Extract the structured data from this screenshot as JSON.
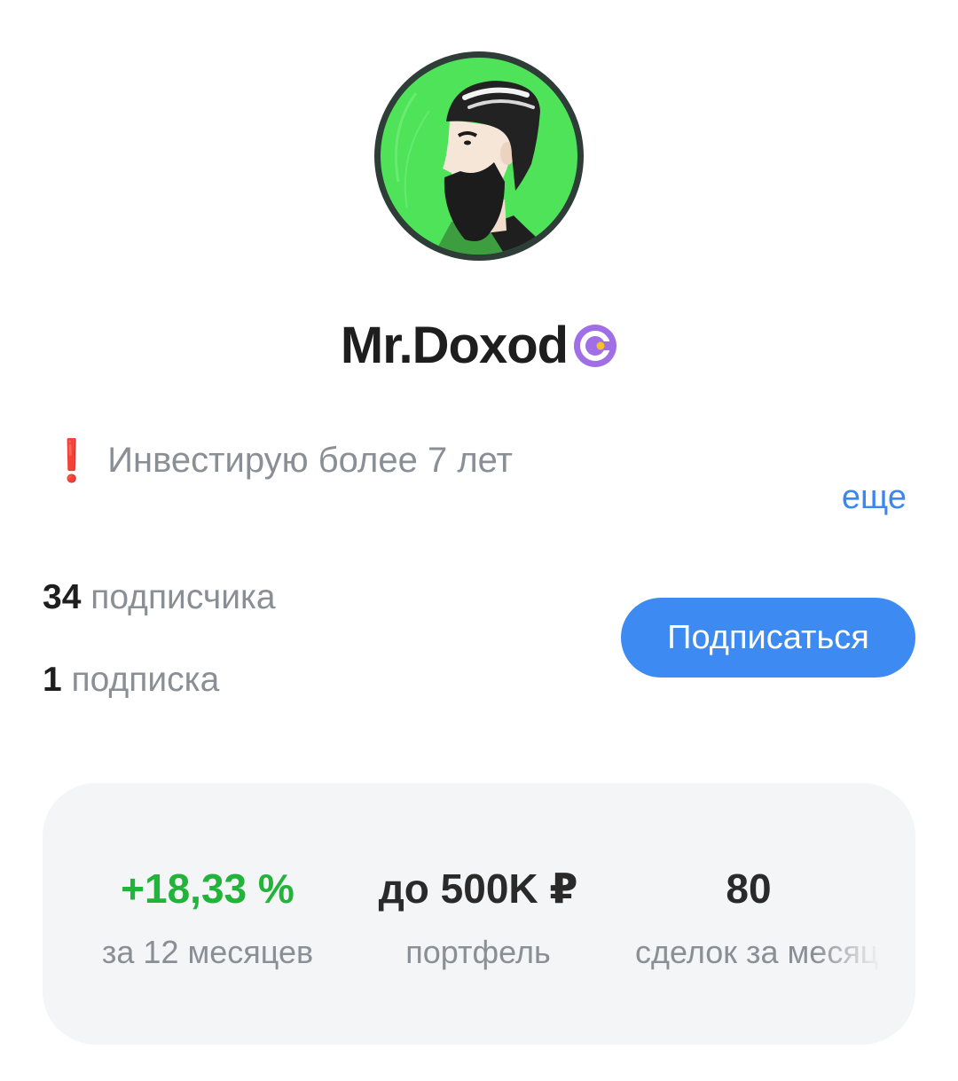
{
  "profile": {
    "name": "Mr.Doxod",
    "avatar_icon": "bearded-man-avatar-icon",
    "badge_icon": "verified-author-icon",
    "badge_color": "#a06fe8"
  },
  "bio": {
    "icon": "❗",
    "text": "Инвестирую более 7 лет",
    "more_label": "еще"
  },
  "stats": {
    "subscribers_count": "34",
    "subscribers_label": "подписчика",
    "subscriptions_count": "1",
    "subscriptions_label": "подписка"
  },
  "subscribe_button": {
    "label": "Подписаться",
    "color": "#3d8bf2"
  },
  "metrics": [
    {
      "value": "+18,33 %",
      "label": "за 12 месяцев",
      "color": "#22b33a"
    },
    {
      "value": "до 500K ₽",
      "label": "портфель"
    },
    {
      "value": "80",
      "label": "сделок за месяц"
    }
  ]
}
